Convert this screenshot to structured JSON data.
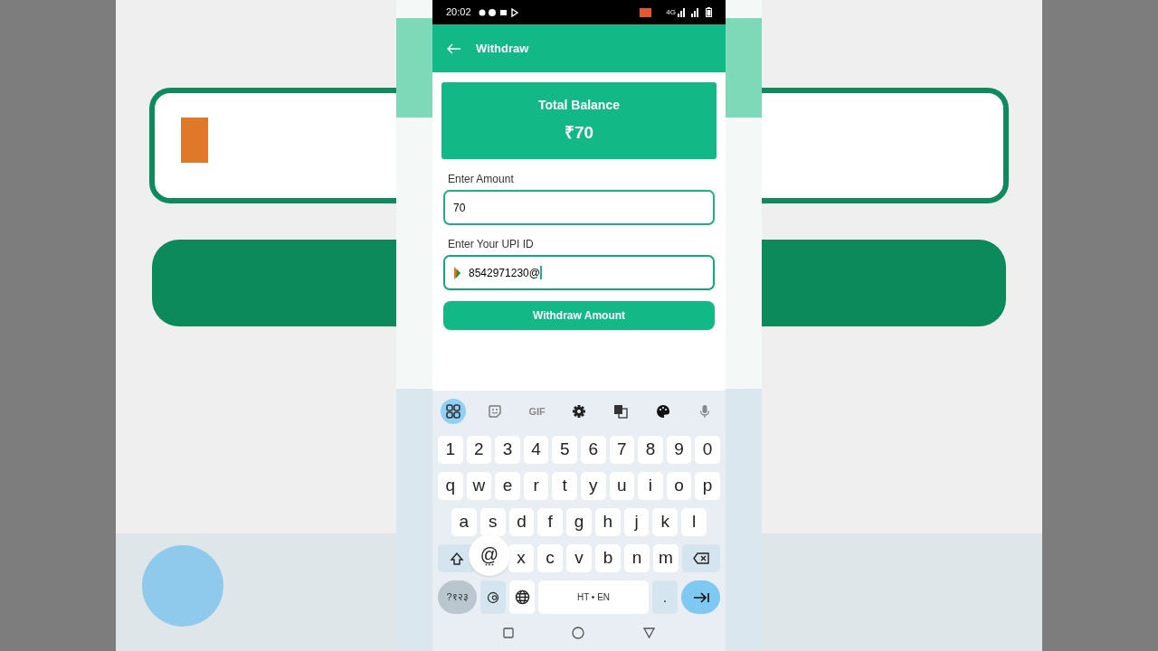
{
  "status_bar": {
    "time": "20:02",
    "network": "4G"
  },
  "header": {
    "title": "Withdraw"
  },
  "balance_card": {
    "label": "Total Balance",
    "amount": "₹70"
  },
  "fields": [
    {
      "kind": "plain",
      "label": "Enter Amount",
      "value": "70",
      "focused": false
    },
    {
      "kind": "upi",
      "label": "Enter Your UPI ID",
      "value": "8542971230@",
      "focused": true
    }
  ],
  "submit_button": "Withdraw Amount",
  "keyboard": {
    "toolbar": [
      {
        "kind": "apps",
        "selected": true
      },
      {
        "kind": "sticker",
        "selected": false
      },
      {
        "kind": "gif",
        "label": "GIF",
        "selected": false
      },
      {
        "kind": "settings",
        "selected": false
      },
      {
        "kind": "translate",
        "selected": false
      },
      {
        "kind": "theme",
        "selected": false
      },
      {
        "kind": "mic",
        "selected": false
      }
    ],
    "rows": [
      [
        "1",
        "2",
        "3",
        "4",
        "5",
        "6",
        "7",
        "8",
        "9",
        "0"
      ],
      [
        "q",
        "w",
        "e",
        "r",
        "t",
        "y",
        "u",
        "i",
        "o",
        "p"
      ],
      [
        "a",
        "s",
        "d",
        "f",
        "g",
        "h",
        "j",
        "k",
        "l"
      ],
      [
        "x",
        "c",
        "v",
        "b",
        "n",
        "m"
      ]
    ],
    "popup_key": "@",
    "symbols_key": "?१२३",
    "space_key": "HT • EN",
    "period_key": "."
  }
}
